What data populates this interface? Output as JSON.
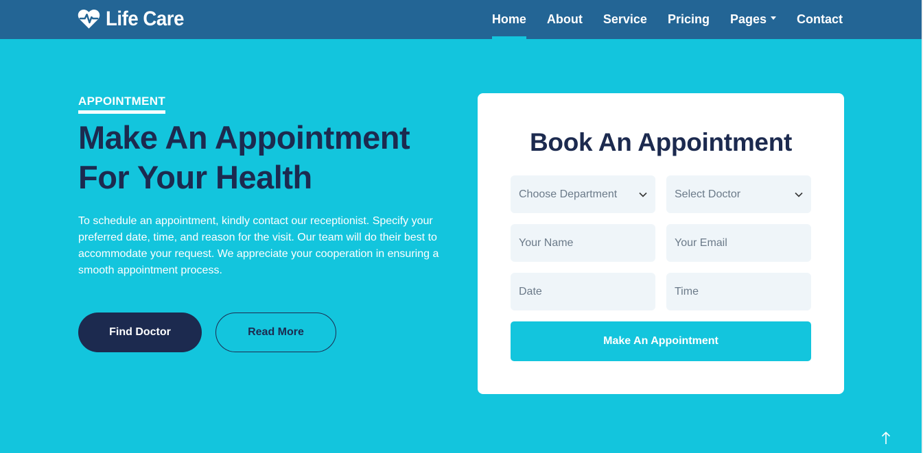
{
  "brand": {
    "name": "Life Care",
    "icon": "heart-pulse-icon"
  },
  "nav": {
    "items": [
      {
        "label": "Home",
        "active": true
      },
      {
        "label": "About"
      },
      {
        "label": "Service"
      },
      {
        "label": "Pricing"
      },
      {
        "label": "Pages",
        "dropdown": true
      },
      {
        "label": "Contact"
      }
    ]
  },
  "hero": {
    "eyebrow": "APPOINTMENT",
    "title": "Make An Appointment For Your Health",
    "description": "To schedule an appointment, kindly contact our receptionist. Specify your preferred date, time, and reason for the visit. Our team will do their best to accommodate your request. We appreciate your cooperation in ensuring a smooth appointment process.",
    "primary_button": "Find Doctor",
    "secondary_button": "Read More"
  },
  "form": {
    "title": "Book An Appointment",
    "department_select": "Choose Department",
    "doctor_select": "Select Doctor",
    "name_placeholder": "Your Name",
    "email_placeholder": "Your Email",
    "date_placeholder": "Date",
    "time_placeholder": "Time",
    "submit_label": "Make An Appointment"
  },
  "colors": {
    "navbar": "#236595",
    "accent": "#13c5dd",
    "dark": "#1c2a4f",
    "field_bg": "#eff5f9"
  },
  "icons": {
    "back_to_top": "arrow-up-icon",
    "select_caret": "chevron-down-icon"
  }
}
